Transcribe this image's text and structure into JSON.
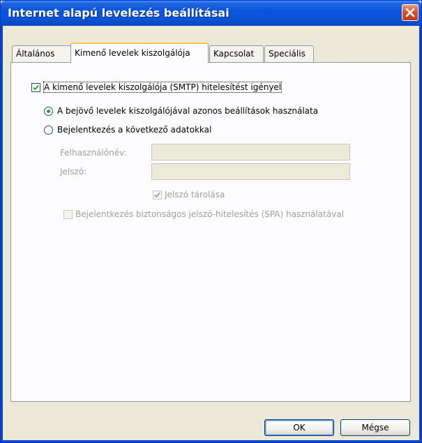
{
  "window": {
    "title": "Internet alapú levelezés beállításai"
  },
  "tabs": [
    {
      "label": "Általános"
    },
    {
      "label": "Kimenő levelek kiszolgálója",
      "active": true
    },
    {
      "label": "Kapcsolat"
    },
    {
      "label": "Speciális"
    }
  ],
  "smtp_auth": {
    "label": "A kimenő levelek kiszolgálója (SMTP) hitelesítést igényel",
    "checked": true
  },
  "auth_options": {
    "same_settings_label": "A bejövő levelek kiszolgálójával azonos beállítások használata",
    "same_settings_selected": true,
    "login_with_label": "Bejelentkezés a következő adatokkal",
    "login_with_selected": false
  },
  "credentials": {
    "username_label": "Felhasználónév:",
    "username_value": "",
    "password_label": "Jelszó:",
    "password_value": "",
    "remember_password_label": "Jelszó tárolása",
    "remember_password_checked": true,
    "spa_label": "Bejelentkezés biztonságos jelszó-hitelesítés (SPA) használatával",
    "spa_checked": false
  },
  "buttons": {
    "ok_label": "OK",
    "cancel_label": "Mégse"
  },
  "colors": {
    "title_bar": "#0a55e0",
    "dialog_bg": "#ece9d8",
    "active_tab_accent": "#ffc73c",
    "close_button": "#d8532c",
    "radio_dot": "#21a121"
  },
  "icons": {
    "close": "close-icon",
    "checkmark": "checkmark-icon"
  }
}
